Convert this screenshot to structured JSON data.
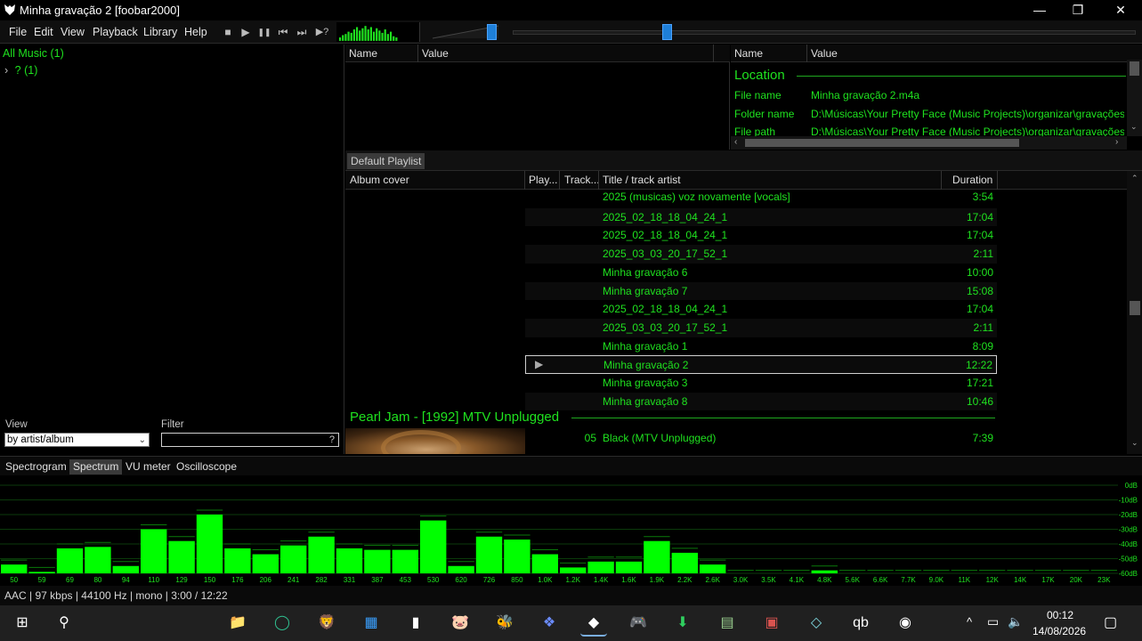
{
  "window": {
    "title": "Minha gravação 2  [foobar2000]",
    "min_icon": "—",
    "max_icon": "❐",
    "close_icon": "✕"
  },
  "menu": [
    {
      "id": "file",
      "label": "File"
    },
    {
      "id": "edit",
      "label": "Edit"
    },
    {
      "id": "view",
      "label": "View"
    },
    {
      "id": "playback",
      "label": "Playback"
    },
    {
      "id": "library",
      "label": "Library"
    },
    {
      "id": "help",
      "label": "Help"
    }
  ],
  "toolbar": {
    "stop_icon": "■",
    "play_icon": "▶",
    "pause_icon": "❚❚",
    "prev_icon": "⏮",
    "next_icon": "⏭",
    "random_icon": "▶?"
  },
  "sliders": {
    "volume_level": 0.88,
    "seek_position": 0.245
  },
  "mini_spectrum": [
    3,
    5,
    6,
    8,
    7,
    10,
    12,
    9,
    11,
    13,
    10,
    12,
    8,
    11,
    9,
    7,
    10,
    6,
    8,
    4,
    3
  ],
  "library": {
    "root": "All Music (1)",
    "child": "? (1)",
    "expander": "›",
    "view_label": "View",
    "view_value": "by artist/album",
    "filter_label": "Filter",
    "filter_help": "?"
  },
  "properties": {
    "col_name": "Name",
    "col_value": "Value",
    "section": "Location",
    "rows": [
      {
        "name": "File name",
        "value": "Minha gravação 2.m4a"
      },
      {
        "name": "Folder name",
        "value": "D:\\Músicas\\Your Pretty Face (Music Projects)\\organizar\\gravações g"
      },
      {
        "name": "File path",
        "value": "D:\\Músicas\\Your Pretty Face (Music Projects)\\organizar\\gravações g"
      }
    ]
  },
  "playlist": {
    "tab": "Default Playlist",
    "columns": {
      "album_cover": "Album cover",
      "playing": "Play...",
      "track": "Track...",
      "title": "Title / track artist",
      "duration": "Duration"
    },
    "rows": [
      {
        "title": "2025 (musicas) voz novamente [vocals]",
        "duration": "3:54"
      },
      {
        "title": "2025_02_18_18_04_24_1",
        "duration": "17:04"
      },
      {
        "title": "2025_02_18_18_04_24_1",
        "duration": "17:04"
      },
      {
        "title": "2025_03_03_20_17_52_1",
        "duration": "2:11"
      },
      {
        "title": "Minha gravação 6",
        "duration": "10:00"
      },
      {
        "title": "Minha gravação 7",
        "duration": "15:08"
      },
      {
        "title": "2025_02_18_18_04_24_1",
        "duration": "17:04"
      },
      {
        "title": "2025_03_03_20_17_52_1",
        "duration": "2:11"
      },
      {
        "title": "Minha gravação 1",
        "duration": "8:09"
      },
      {
        "title": "Minha gravação 2",
        "duration": "12:22",
        "playing": true
      },
      {
        "title": "Minha gravação 3",
        "duration": "17:21"
      },
      {
        "title": "Minha gravação 8",
        "duration": "10:46"
      }
    ],
    "group_header": "Pearl Jam - [1992] MTV Unplugged",
    "group_row": {
      "track": "05",
      "title": "Black (MTV Unplugged)",
      "duration": "7:39"
    },
    "play_marker": "▶"
  },
  "vis_tabs": [
    "Spectrogram",
    "Spectrum",
    "VU meter",
    "Oscilloscope"
  ],
  "vis_active": "Spectrum",
  "spectrum": {
    "db_labels": [
      "0dB",
      "-10dB",
      "-20dB",
      "-30dB",
      "-40dB",
      "-50dB",
      "-60dB"
    ],
    "freq_labels": [
      "50",
      "59",
      "69",
      "80",
      "94",
      "110",
      "129",
      "150",
      "176",
      "206",
      "241",
      "282",
      "331",
      "387",
      "453",
      "530",
      "620",
      "726",
      "850",
      "1.0K",
      "1.2K",
      "1.4K",
      "1.6K",
      "1.9K",
      "2.2K",
      "2.6K",
      "3.0K",
      "3.5K",
      "4.1K",
      "4.8K",
      "5.6K",
      "6.6K",
      "7.7K",
      "9.0K",
      "11K",
      "12K",
      "14K",
      "17K",
      "20K",
      "23K"
    ],
    "levels_db": [
      -54,
      -59,
      -43,
      -42,
      -55,
      -30,
      -38,
      -20,
      -43,
      -47,
      -41,
      -35,
      -43,
      -44,
      -44,
      -24,
      -55,
      -35,
      -37,
      -47,
      -56,
      -52,
      -52,
      -38,
      -46,
      -54,
      -61,
      -61,
      -61,
      -58,
      -61,
      -61,
      -61,
      -61,
      -61,
      -61,
      -61,
      -61,
      -61,
      -61
    ],
    "bar_color": "#00ff00"
  },
  "status": "AAC | 97 kbps | 44100 Hz | mono | 3:00 / 12:22",
  "taskbar": {
    "icons": [
      {
        "name": "start-icon",
        "glyph": "⊞",
        "color": "#ffffff"
      },
      {
        "name": "search-icon",
        "glyph": "⚲",
        "color": "#ffffff"
      },
      {
        "name": "file-explorer-icon",
        "glyph": "📁",
        "color": "#e8b84a"
      },
      {
        "name": "opera-gx-icon",
        "glyph": "◯",
        "color": "#2fbf8f"
      },
      {
        "name": "brave-icon",
        "glyph": "🦁",
        "color": "#fb542b"
      },
      {
        "name": "microsoft-store-icon",
        "glyph": "▦",
        "color": "#3aa0ff"
      },
      {
        "name": "audio-app-icon",
        "glyph": "▮",
        "color": "#ffffff"
      },
      {
        "name": "pig-app-icon",
        "glyph": "🐷",
        "color": "#f2b6b6"
      },
      {
        "name": "bee-app-icon",
        "glyph": "🐝",
        "color": "#e8d24a"
      },
      {
        "name": "network-app-icon",
        "glyph": "❖",
        "color": "#6a8bff"
      },
      {
        "name": "foobar2000-icon",
        "glyph": "◆",
        "color": "#ffffff"
      },
      {
        "name": "gamepad-icon",
        "glyph": "🎮",
        "color": "#cfd6ff"
      },
      {
        "name": "green-download-icon",
        "glyph": "⬇",
        "color": "#2fcf5f"
      },
      {
        "name": "notepad-icon",
        "glyph": "▤",
        "color": "#9ad08f"
      },
      {
        "name": "calendar-app-icon",
        "glyph": "▣",
        "color": "#d9534f"
      },
      {
        "name": "cube-app-icon",
        "glyph": "◇",
        "color": "#7fd9e0"
      },
      {
        "name": "qbittorrent-icon",
        "glyph": "qb",
        "color": "#ffffff"
      },
      {
        "name": "obs-icon",
        "glyph": "◉",
        "color": "#ffffff"
      }
    ],
    "tray_chevron": "^",
    "tray_network": "▭",
    "tray_volume": "🔈",
    "time": "00:12",
    "date": "14/08/2026",
    "notification_icon": "▢"
  }
}
